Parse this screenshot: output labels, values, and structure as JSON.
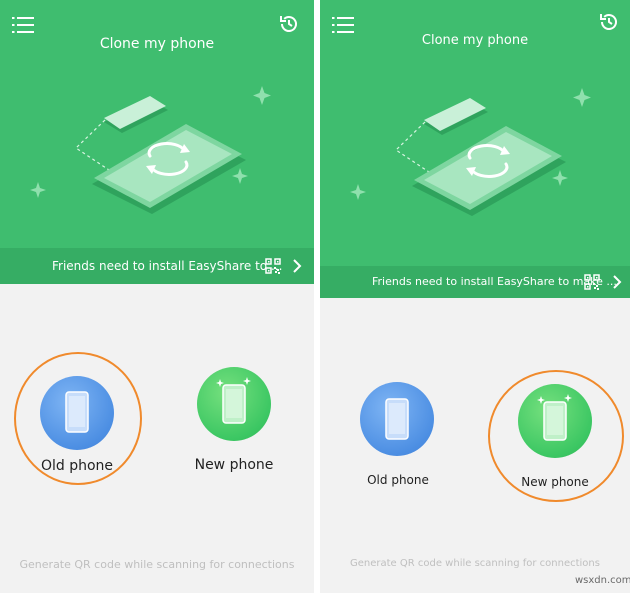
{
  "left": {
    "title": "Clone my phone",
    "banner_text": "Friends need to install EasyShare to ...",
    "old_phone_label": "Old phone",
    "new_phone_label": "New phone",
    "footer_hint": "Generate QR code while scanning for connections"
  },
  "right": {
    "title": "Clone my phone",
    "banner_text": "Friends need to install EasyShare to make ...",
    "old_phone_label": "Old phone",
    "new_phone_label": "New phone",
    "footer_hint": "Generate QR code while scanning for connections"
  },
  "watermark": "wsxdn.com",
  "colors": {
    "hero_green": "#3fbd6f",
    "banner_green": "#36ad64",
    "old_phone_blue": "#4d8fe3",
    "new_phone_green": "#3cc763",
    "highlight_orange": "#f08a2c"
  },
  "icons": {
    "menu": "menu-icon",
    "history": "history-icon",
    "qr": "qr-code-icon",
    "chevron": "chevron-right-icon"
  }
}
